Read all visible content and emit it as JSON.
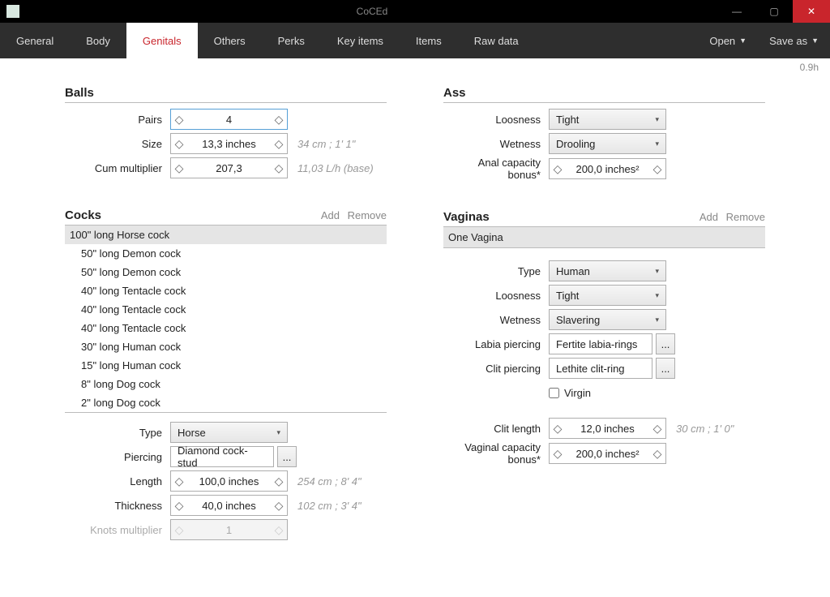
{
  "window": {
    "title": "CoCEd",
    "status": "0.9h"
  },
  "menu": {
    "tabs": [
      "General",
      "Body",
      "Genitals",
      "Others",
      "Perks",
      "Key items",
      "Items",
      "Raw data"
    ],
    "active": "Genitals",
    "actions": {
      "open": "Open",
      "saveas": "Save as"
    }
  },
  "balls": {
    "title": "Balls",
    "labels": {
      "pairs": "Pairs",
      "size": "Size",
      "cum": "Cum multiplier"
    },
    "pairs": "4",
    "size": "13,3 inches",
    "size_hint": "34 cm ; 1' 1\"",
    "cum": "207,3",
    "cum_hint": "11,03 L/h (base)"
  },
  "ass": {
    "title": "Ass",
    "labels": {
      "loosness": "Loosness",
      "wetness": "Wetness",
      "capacity": "Anal capacity bonus*"
    },
    "loosness": "Tight",
    "wetness": "Drooling",
    "capacity": "200,0 inches²"
  },
  "cocks": {
    "title": "Cocks",
    "add": "Add",
    "remove": "Remove",
    "items": [
      "100\" long Horse cock",
      "50\" long Demon cock",
      "50\" long Demon cock",
      "40\" long Tentacle cock",
      "40\" long Tentacle cock",
      "40\" long Tentacle cock",
      "30\" long Human cock",
      "15\" long Human cock",
      "8\" long Dog cock",
      "2\" long Dog cock"
    ],
    "labels": {
      "type": "Type",
      "piercing": "Piercing",
      "length": "Length",
      "thickness": "Thickness",
      "knots": "Knots multiplier"
    },
    "type": "Horse",
    "piercing": "Diamond cock-stud",
    "length": "100,0 inches",
    "length_hint": "254 cm ; 8' 4\"",
    "thickness": "40,0 inches",
    "thickness_hint": "102 cm ; 3' 4\"",
    "knots": "1"
  },
  "vaginas": {
    "title": "Vaginas",
    "add": "Add",
    "remove": "Remove",
    "item": "One Vagina",
    "labels": {
      "type": "Type",
      "loosness": "Loosness",
      "wetness": "Wetness",
      "labia": "Labia piercing",
      "clit": "Clit piercing",
      "virgin": "Virgin",
      "clitlen": "Clit length",
      "capacity": "Vaginal capacity bonus*"
    },
    "type": "Human",
    "loosness": "Tight",
    "wetness": "Slavering",
    "labia": "Fertite labia-rings",
    "clit": "Lethite clit-ring",
    "clitlen": "12,0 inches",
    "clitlen_hint": "30 cm ; 1' 0\"",
    "capacity": "200,0 inches²"
  },
  "ui": {
    "more": "...",
    "dec": "◇",
    "inc": "◇"
  }
}
